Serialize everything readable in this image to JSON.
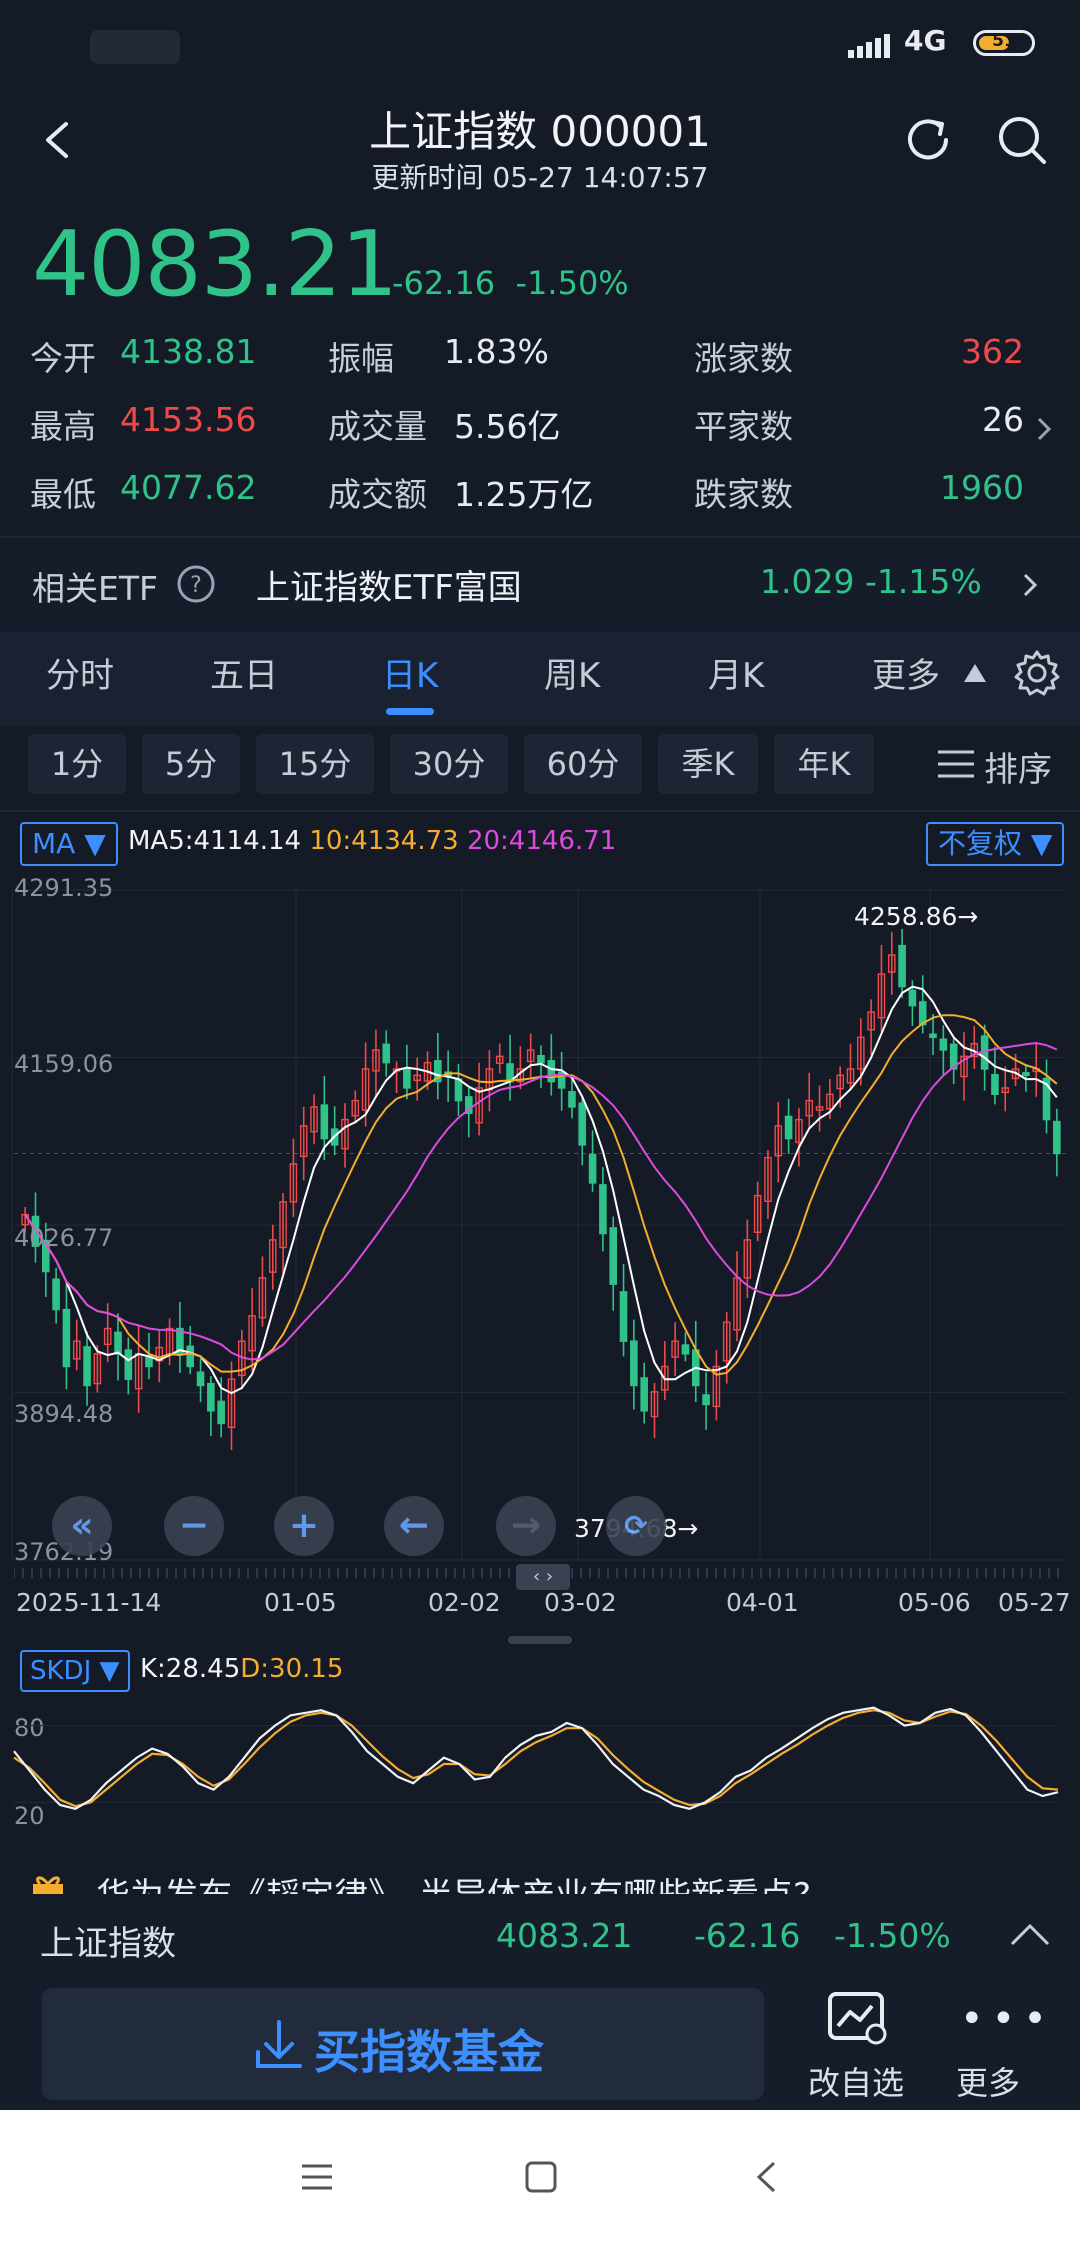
{
  "status": {
    "network": "4G",
    "battery": "51"
  },
  "header": {
    "title": "上证指数 000001",
    "update_time": "更新时间 05-27 14:07:57"
  },
  "quote": {
    "price": "4083.21",
    "change": "-62.16",
    "change_pct": "-1.50%"
  },
  "stats": [
    {
      "label": "今开",
      "value": "4138.81",
      "color": "#2fc38a"
    },
    {
      "label": "最高",
      "value": "4153.56",
      "color": "#ef4a4a"
    },
    {
      "label": "最低",
      "value": "4077.62",
      "color": "#2fc38a"
    },
    {
      "label": "振幅",
      "value": "1.83%",
      "color": "#e7ebf2"
    },
    {
      "label": "成交量",
      "value": "5.56亿",
      "color": "#e7ebf2"
    },
    {
      "label": "成交额",
      "value": "1.25万亿",
      "color": "#e7ebf2"
    },
    {
      "label": "涨家数",
      "value": "362",
      "color": "#ef4a4a"
    },
    {
      "label": "平家数",
      "value": "26",
      "color": "#e7ebf2"
    },
    {
      "label": "跌家数",
      "value": "1960",
      "color": "#2fc38a"
    }
  ],
  "etf": {
    "label": "相关ETF",
    "name": "上证指数ETF富国",
    "price": "1.029",
    "pct": "-1.15%"
  },
  "tabs": [
    "分时",
    "五日",
    "日K",
    "周K",
    "月K",
    "更多"
  ],
  "active_tab": "日K",
  "periods": [
    "1分",
    "5分",
    "15分",
    "30分",
    "60分",
    "季K",
    "年K"
  ],
  "sort_label": "排序",
  "ma": {
    "label": "MA",
    "ma5": "MA5:4114.14",
    "ma10": "10:4134.73",
    "ma20": "20:4146.71",
    "adjust": "不复权"
  },
  "chart_data": {
    "type": "candlestick",
    "y_ticks": [
      "4291.35",
      "4159.06",
      "4026.77",
      "3894.48",
      "3762.19"
    ],
    "ylim": [
      3762.19,
      4291.35
    ],
    "x_ticks": [
      "2025-11-14",
      "01-05",
      "02-02",
      "03-02",
      "04-01",
      "05-06",
      "05-27"
    ],
    "annotations": [
      {
        "text": "4258.86→"
      },
      {
        "text": "3794.68→"
      }
    ],
    "series": [
      {
        "name": "MA5",
        "color": "#ffffff"
      },
      {
        "name": "MA10",
        "color": "#f4ad2f"
      },
      {
        "name": "MA20",
        "color": "#dc4be0"
      }
    ],
    "close": [
      4035,
      4010,
      3990,
      3960,
      3915,
      3935,
      3900,
      3925,
      3945,
      3925,
      3905,
      3925,
      3915,
      3930,
      3945,
      3925,
      3915,
      3900,
      3880,
      3870,
      3905,
      3935,
      3955,
      3985,
      4015,
      4045,
      4075,
      4105,
      4120,
      4095,
      4090,
      4110,
      4125,
      4150,
      4165,
      4155,
      4150,
      4135,
      4145,
      4155,
      4140,
      4145,
      4125,
      4115,
      4135,
      4150,
      4160,
      4140,
      4150,
      4165,
      4155,
      4140,
      4135,
      4120,
      4090,
      4060,
      4020,
      3980,
      3935,
      3900,
      3880,
      3895,
      3915,
      3935,
      3925,
      3900,
      3885,
      3915,
      3950,
      3985,
      4015,
      4050,
      4080,
      4105,
      4095,
      4110,
      4125,
      4120,
      4130,
      4145,
      4150,
      4175,
      4195,
      4225,
      4240,
      4215,
      4200,
      4185,
      4175,
      4165,
      4150,
      4160,
      4170,
      4150,
      4130,
      4135,
      4150,
      4145,
      4150,
      4110,
      4083.21
    ]
  },
  "indicator": {
    "label": "SKDJ",
    "k": "K:28.45",
    "d": "D:30.15",
    "levels": [
      "80",
      "20"
    ],
    "k_values": [
      60,
      45,
      30,
      18,
      15,
      22,
      35,
      45,
      55,
      62,
      58,
      48,
      35,
      30,
      40,
      55,
      70,
      80,
      88,
      90,
      92,
      88,
      75,
      60,
      50,
      40,
      35,
      45,
      55,
      50,
      38,
      40,
      55,
      65,
      72,
      75,
      82,
      78,
      65,
      50,
      40,
      30,
      25,
      18,
      15,
      20,
      28,
      40,
      45,
      55,
      62,
      70,
      78,
      85,
      90,
      92,
      94,
      88,
      80,
      82,
      90,
      93,
      88,
      75,
      60,
      45,
      30,
      25,
      28
    ],
    "d_values": [
      55,
      47,
      35,
      22,
      17,
      20,
      30,
      40,
      50,
      58,
      57,
      50,
      40,
      33,
      38,
      50,
      63,
      74,
      83,
      88,
      90,
      88,
      80,
      68,
      56,
      46,
      39,
      42,
      50,
      50,
      42,
      41,
      50,
      60,
      67,
      72,
      78,
      78,
      70,
      57,
      46,
      36,
      29,
      22,
      18,
      19,
      25,
      35,
      42,
      50,
      58,
      65,
      73,
      80,
      86,
      90,
      92,
      90,
      84,
      82,
      87,
      91,
      89,
      80,
      68,
      54,
      40,
      31,
      30
    ]
  },
  "news": {
    "text": "华为发布《韬定律》，半导体产业有哪些新看点?"
  },
  "bottom_quote": {
    "name": "上证指数",
    "price": "4083.21",
    "change": "-62.16",
    "pct": "-1.50%"
  },
  "actions": {
    "buy": "买指数基金",
    "watch": "改自选",
    "more": "更多"
  }
}
